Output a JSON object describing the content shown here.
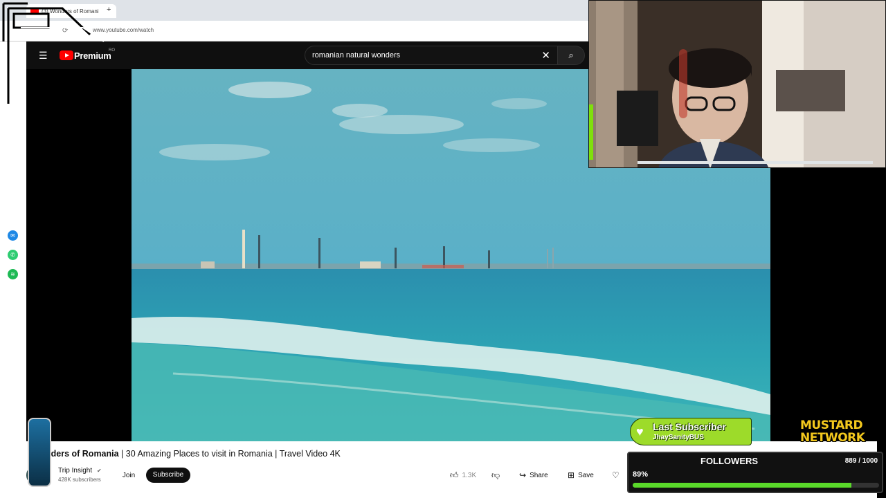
{
  "browser": {
    "tab_title": "(3) Wonders of Romani",
    "new_tab_label": "+",
    "url": "www.youtube.com/watch"
  },
  "youtube": {
    "brand": "Premium",
    "region": "RO",
    "search_value": "romanian natural wonders",
    "accent_color": "#ff0000"
  },
  "video": {
    "title_start": "nders of Romania",
    "title_rest": " | 30 Amazing Places to visit in Romania | Travel Video 4K",
    "channel": "Trip Insight",
    "subscribers": "428K subscribers",
    "join_label": "Join",
    "subscribe_label": "Subscribe",
    "likes": "1.3K",
    "share_label": "Share",
    "save_label": "Save"
  },
  "overlay": {
    "last_subscriber_title": "Last Subscriber",
    "last_subscriber_name": "JhaySanityBUS",
    "network_line1": "MUSTARD",
    "network_line2": "NETWORK",
    "followers_label": "FOLLOWERS",
    "followers_count": "889 / 1000",
    "followers_percent": "89%",
    "followers_fraction": 0.889,
    "bar_color": "#5ad92a"
  }
}
